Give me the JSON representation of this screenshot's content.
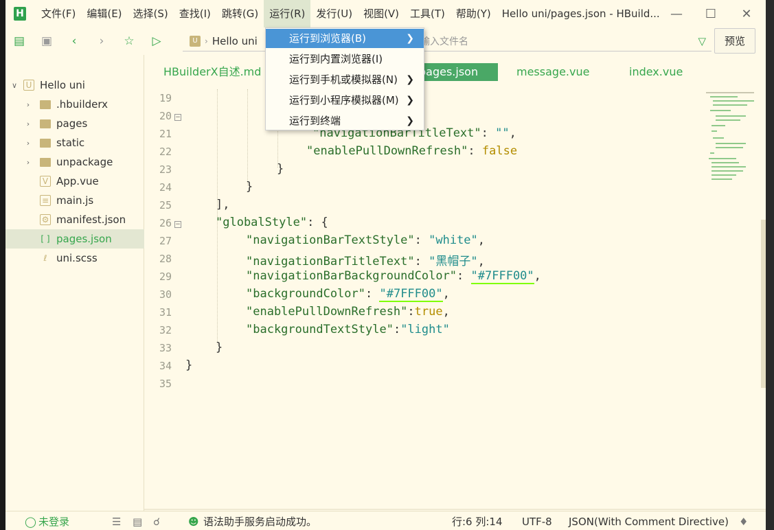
{
  "menubar": {
    "items": [
      "文件(F)",
      "编辑(E)",
      "选择(S)",
      "查找(I)",
      "跳转(G)",
      "运行(R)",
      "发行(U)",
      "视图(V)",
      "工具(T)",
      "帮助(Y)"
    ],
    "window_title": "Hello uni/pages.json - HBuild..."
  },
  "toolbar": {
    "address_project": "Hello uni",
    "search_placeholder": "输入文件名",
    "preview_label": "预览"
  },
  "run_menu": {
    "items": [
      {
        "label": "运行到浏览器(B)",
        "has_submenu": true,
        "highlighted": true
      },
      {
        "label": "运行到内置浏览器(I)",
        "has_submenu": false
      },
      {
        "label": "运行到手机或模拟器(N)",
        "has_submenu": true
      },
      {
        "label": "运行到小程序模拟器(M)",
        "has_submenu": true
      },
      {
        "label": "运行到终端",
        "has_submenu": true
      }
    ]
  },
  "sidebar": {
    "project": "Hello uni",
    "items": [
      {
        "label": ".hbuilderx",
        "type": "folder"
      },
      {
        "label": "pages",
        "type": "folder"
      },
      {
        "label": "static",
        "type": "folder"
      },
      {
        "label": "unpackage",
        "type": "folder"
      },
      {
        "label": "App.vue",
        "type": "file"
      },
      {
        "label": "main.js",
        "type": "file"
      },
      {
        "label": "manifest.json",
        "type": "file"
      },
      {
        "label": "pages.json",
        "type": "file",
        "selected": true
      },
      {
        "label": "uni.scss",
        "type": "file"
      }
    ]
  },
  "tabs": [
    {
      "label": "HBuilderX自述.md"
    },
    {
      "label": "pages.json",
      "active": true
    },
    {
      "label": "message.vue"
    },
    {
      "label": "index.vue"
    }
  ],
  "editor": {
    "line_numbers": [
      "19",
      "20",
      "21",
      "22",
      "23",
      "24",
      "25",
      "26",
      "27",
      "28",
      "29",
      "30",
      "31",
      "32",
      "33",
      "34",
      "35"
    ],
    "lines": [
      "",
      "",
      "\"navigationBarTitleText\": \"\",",
      "\"enablePullDownRefresh\": false",
      "}",
      "}",
      "],",
      "\"globalStyle\": {",
      "\"navigationBarTextStyle\": \"white\",",
      "\"navigationBarTitleText\": \"黑帽子\",",
      "\"navigationBarBackgroundColor\": \"#7FFF00\",",
      "\"backgroundColor\": \"#7FFF00\",",
      "\"enablePullDownRefresh\":true,",
      "\"backgroundTextStyle\":\"light\"",
      "}",
      "}",
      ""
    ]
  },
  "statusbar": {
    "login": "未登录",
    "message": "语法助手服务启动成功。",
    "position": "行:6  列:14",
    "encoding": "UTF-8",
    "language": "JSON(With Comment Directive)"
  },
  "colors": {
    "background": "#fffae8",
    "accent": "#36a64d",
    "menu_highlight": "#4a95d6",
    "tab_active": "#4aa866"
  }
}
